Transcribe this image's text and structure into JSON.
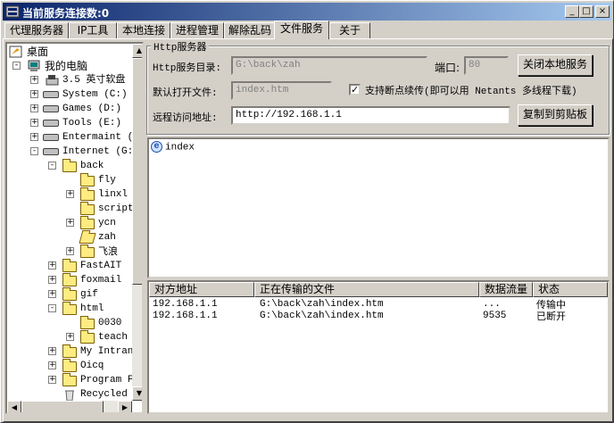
{
  "title": "当前服务连接数:0",
  "title_buttons": {
    "minimize": "_",
    "maximize": "□",
    "close": "×"
  },
  "tabs": [
    {
      "label": "代理服务器"
    },
    {
      "label": "IP工具"
    },
    {
      "label": "本地连接"
    },
    {
      "label": "进程管理"
    },
    {
      "label": "解除乱码"
    },
    {
      "label": "文件服务"
    },
    {
      "label": "关于"
    }
  ],
  "active_tab": "文件服务",
  "tree": {
    "items": [
      {
        "label": "桌面",
        "icon": "desktop-icon",
        "toggle": ""
      },
      {
        "label": "我的电脑",
        "icon": "computer-icon",
        "toggle": "-"
      },
      {
        "label": "3.5 英寸软盘",
        "icon": "floppy-icon",
        "toggle": "+"
      },
      {
        "label": "System (C:)",
        "icon": "drive-icon",
        "toggle": "+"
      },
      {
        "label": "Games (D:)",
        "icon": "drive-icon",
        "toggle": "+"
      },
      {
        "label": "Tools (E:)",
        "icon": "drive-icon",
        "toggle": "+"
      },
      {
        "label": "Entermaint (",
        "icon": "drive-icon",
        "toggle": "+"
      },
      {
        "label": "Internet (G:",
        "icon": "drive-icon",
        "toggle": "-"
      },
      {
        "label": "back",
        "icon": "folder-icon",
        "toggle": "-"
      },
      {
        "label": "fly",
        "icon": "folder-icon",
        "toggle": ""
      },
      {
        "label": "linxl",
        "icon": "folder-icon",
        "toggle": "+"
      },
      {
        "label": "script",
        "icon": "folder-icon",
        "toggle": ""
      },
      {
        "label": "ycn",
        "icon": "folder-icon",
        "toggle": "+"
      },
      {
        "label": "zah",
        "icon": "folder-open-icon",
        "toggle": ""
      },
      {
        "label": "飞浪",
        "icon": "folder-icon",
        "toggle": "+"
      },
      {
        "label": "FastAIT",
        "icon": "folder-icon",
        "toggle": "+"
      },
      {
        "label": "foxmail",
        "icon": "folder-icon",
        "toggle": "+"
      },
      {
        "label": "gif",
        "icon": "folder-icon",
        "toggle": "+"
      },
      {
        "label": "html",
        "icon": "folder-icon",
        "toggle": "-"
      },
      {
        "label": "0030",
        "icon": "folder-icon",
        "toggle": ""
      },
      {
        "label": "teach",
        "icon": "folder-icon",
        "toggle": "+"
      },
      {
        "label": "My Intran",
        "icon": "folder-icon",
        "toggle": "+"
      },
      {
        "label": "Oicq",
        "icon": "folder-icon",
        "toggle": "+"
      },
      {
        "label": "Program F",
        "icon": "folder-icon",
        "toggle": "+"
      },
      {
        "label": "Recycled",
        "icon": "recycle-bin-icon",
        "toggle": ""
      }
    ]
  },
  "http": {
    "group_title": "Http服务器",
    "dir_label": "Http服务目录:",
    "dir_value": "G:\\back\\zah",
    "port_label": "端口:",
    "port_value": "80",
    "close_button": "关闭本地服务",
    "default_file_label": "默认打开文件:",
    "default_file_value": "index.htm",
    "resume_checkbox_label": "支持断点续传(即可以用 Netants 多线程下载)",
    "resume_checked": true,
    "remote_label": "远程访问地址:",
    "remote_value": "http://192.168.1.1",
    "copy_button": "复制到剪贴板"
  },
  "files": [
    {
      "name": "index",
      "icon": "ie-html-icon"
    }
  ],
  "transfers": {
    "headers": [
      "对方地址",
      "正在传输的文件",
      "数据流量",
      "状态"
    ],
    "rows": [
      {
        "address": "192.168.1.1",
        "file": "G:\\back\\zah\\index.htm",
        "traffic": "...",
        "status": "传输中"
      },
      {
        "address": "192.168.1.1",
        "file": "G:\\back\\zah\\index.htm",
        "traffic": "9535",
        "status": "已断开"
      }
    ]
  }
}
